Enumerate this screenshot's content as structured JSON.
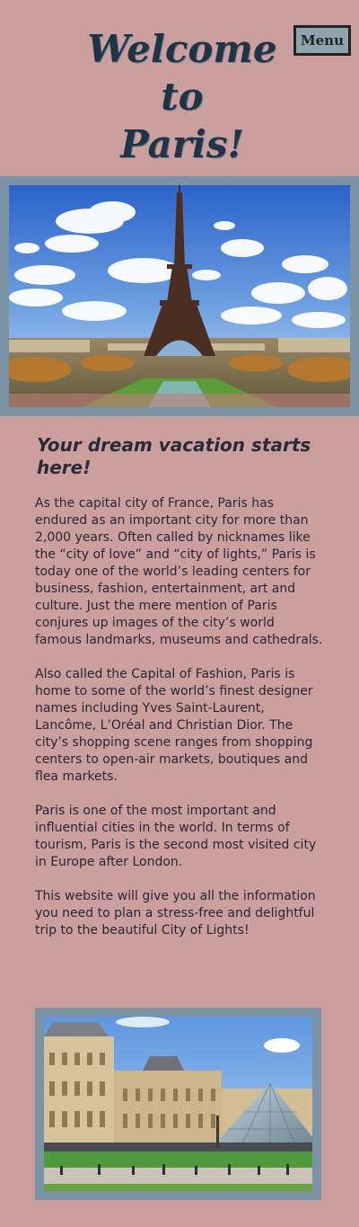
{
  "header": {
    "title_line1": "Welcome",
    "title_line2": "to",
    "title_line3": "Paris!",
    "menu_label": "Menu"
  },
  "hero": {
    "image_subject": "Eiffel Tower"
  },
  "article": {
    "heading": "Your dream vacation starts here!",
    "paragraphs": [
      "As the capital city of France, Paris has endured as an important city for more than 2,000 years. Often called by nicknames like the “city of love” and “city of lights,” Paris is today one of the world’s leading centers for business, fashion, entertainment, art and culture. Just the mere mention of Paris conjures up images of the city’s world famous landmarks, museums and cathedrals.",
      "Also called the Capital of Fashion, Paris is home to some of the world’s finest designer names including Yves Saint-Laurent, Lancôme, L’Oréal and Christian Dior. The city’s shopping scene ranges from shopping centers to open-air markets, boutiques and flea markets.",
      "Paris is one of the most important and influential cities in the world. In terms of tourism, Paris is the second most visited city in Europe after London.",
      "This website will give you all the information you need to plan a stress-free and delightful trip to the beautiful City of Lights!"
    ]
  },
  "gallery": {
    "image_subject": "Louvre Museum and Pyramid"
  },
  "colors": {
    "background": "#cc9f9f",
    "frame": "#7b93a4",
    "title": "#223344",
    "text": "#262634",
    "menu_bg": "#8fa3ad"
  }
}
